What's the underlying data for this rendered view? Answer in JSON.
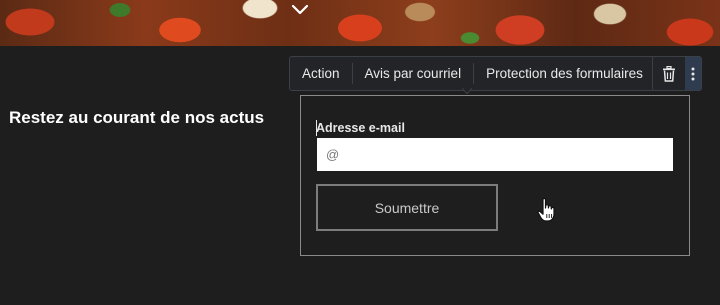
{
  "toolbar": {
    "items": [
      {
        "label": "Action"
      },
      {
        "label": "Avis par courriel"
      },
      {
        "label": "Protection des formulaires"
      }
    ],
    "icons": [
      "trash-icon",
      "more-vertical-icon"
    ]
  },
  "newsletter": {
    "heading": "Restez au courant de nos actus",
    "email_label": "Adresse e-mail",
    "email_placeholder": "@",
    "email_value": "",
    "submit_label": "Soumettre"
  },
  "colors": {
    "background": "#1e1e1e",
    "toolbar_bg": "#222428",
    "toolbar_border": "#3b3f46",
    "more_button_bg": "#2f3b4f",
    "form_border": "#8a8a8a"
  }
}
